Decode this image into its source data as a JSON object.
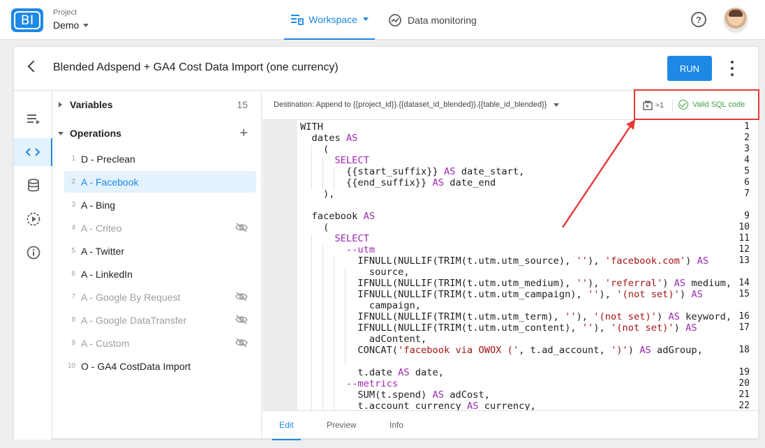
{
  "header": {
    "project_label": "Project",
    "project_name": "Demo",
    "nav_workspace": "Workspace",
    "nav_monitoring": "Data monitoring",
    "help_glyph": "?"
  },
  "card": {
    "title": "Blended Adspend + GA4 Cost Data Import (one currency)",
    "run_label": "RUN"
  },
  "tree": {
    "variables_label": "Variables",
    "variables_count": "15",
    "operations_label": "Operations",
    "operations": [
      {
        "num": "1",
        "name": "D - Preclean",
        "state": "normal"
      },
      {
        "num": "2",
        "name": "A - Facebook",
        "state": "active"
      },
      {
        "num": "3",
        "name": "A - Bing",
        "state": "normal"
      },
      {
        "num": "4",
        "name": "A - Criteo",
        "state": "disabled"
      },
      {
        "num": "5",
        "name": "A - Twitter",
        "state": "normal"
      },
      {
        "num": "6",
        "name": "A - LinkedIn",
        "state": "normal"
      },
      {
        "num": "7",
        "name": "A - Google By Request",
        "state": "disabled"
      },
      {
        "num": "8",
        "name": "A - Google DataTransfer",
        "state": "disabled"
      },
      {
        "num": "9",
        "name": "A - Custom",
        "state": "disabled"
      },
      {
        "num": "10",
        "name": "O - GA4 CostData Import",
        "state": "normal"
      }
    ]
  },
  "editor": {
    "destination": "Destination: Append to {{project_id}}.{{dataset_id_blended}}.{{table_id_blended}}",
    "rows_badge": "≈1",
    "valid_label": "Valid SQL code",
    "tabs": [
      "Edit",
      "Preview",
      "Info"
    ],
    "line_numbers": [
      "1",
      "2",
      "3",
      "4",
      "5",
      "6",
      "7",
      "",
      "9",
      "10",
      "11",
      "12",
      "13",
      "",
      "14",
      "15",
      "",
      "16",
      "17",
      "",
      "18",
      "",
      "19",
      "20",
      "21",
      "22"
    ],
    "code": {
      "l1": "WITH",
      "l2a": "  dates ",
      "l2b": "AS",
      "l3": "    (",
      "l4": "      SELECT",
      "l5a": "        {{start_suffix}} ",
      "l5b": "AS",
      "l5c": " date_start,",
      "l6a": "        {{end_suffix}} ",
      "l6b": "AS",
      "l6c": " date_end",
      "l7": "    ),",
      "l9a": "  facebook ",
      "l9b": "AS",
      "l10": "    (",
      "l11": "      SELECT",
      "l12": "        --utm",
      "l13a": "          IFNULL(NULLIF(TRIM(t.utm.utm_source), ",
      "l13b": "''",
      "l13c": "), ",
      "l13d": "'facebook.com'",
      "l13e": ") ",
      "l13f": "AS",
      "l13g": "            source,",
      "l14a": "          IFNULL(NULLIF(TRIM(t.utm.utm_medium), ",
      "l14b": "''",
      "l14c": "), ",
      "l14d": "'referral'",
      "l14e": ") ",
      "l14f": "AS",
      "l14g": " medium,",
      "l15a": "          IFNULL(NULLIF(TRIM(t.utm.utm_campaign), ",
      "l15b": "''",
      "l15c": "), ",
      "l15d": "'(not set)'",
      "l15e": ") ",
      "l15f": "AS",
      "l15g": "            campaign,",
      "l16a": "          IFNULL(NULLIF(TRIM(t.utm.utm_term), ",
      "l16b": "''",
      "l16c": "), ",
      "l16d": "'(not set)'",
      "l16e": ") ",
      "l16f": "AS",
      "l16g": " keyword,",
      "l17a": "          IFNULL(NULLIF(TRIM(t.utm.utm_content), ",
      "l17b": "''",
      "l17c": "), ",
      "l17d": "'(not set)'",
      "l17e": ") ",
      "l17f": "AS",
      "l17g": "            adContent,",
      "l18a": "          CONCAT(",
      "l18b": "'facebook via OWOX ('",
      "l18c": ", t.ad_account, ",
      "l18d": "')'",
      "l18e": ") ",
      "l18f": "AS",
      "l18g": " adGroup,",
      "l19a": "          t.date ",
      "l19b": "AS",
      "l19c": " date,",
      "l20": "        --metrics",
      "l21a": "          SUM(t.spend) ",
      "l21b": "AS",
      "l21c": " adCost,",
      "l22a": "          t.account_currency ",
      "l22b": "AS",
      "l22c": " currency,"
    }
  },
  "colors": {
    "accent": "#1e88e5",
    "valid": "#43a047",
    "annotation": "#e53935",
    "keyword": "#9c27b0",
    "string": "#a31515"
  }
}
